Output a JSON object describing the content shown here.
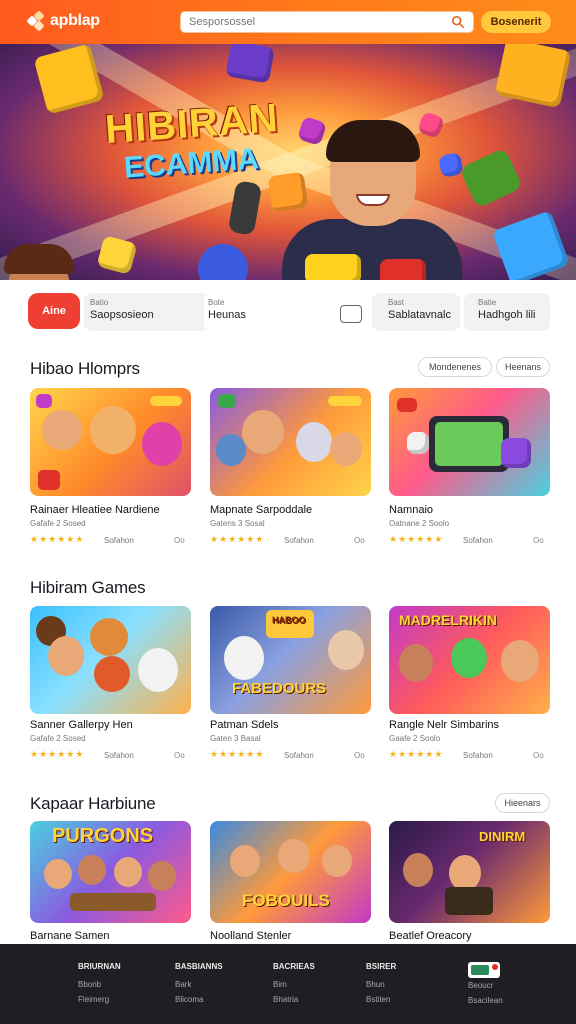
{
  "header": {
    "logo_text": "apblap",
    "search_placeholder": "Sesporsossel",
    "cta_label": "Bosenerit"
  },
  "hero": {
    "title": "HIBIRAN",
    "subtitle": "ECAMMA"
  },
  "filters": {
    "primary_chip": "Aine",
    "chip1": {
      "caption": "Batio",
      "value": "Saopsosieon"
    },
    "chip2": {
      "caption": "Bote",
      "value": "Heunas"
    },
    "chip3": {
      "caption": "Bast",
      "value": "Sablatavnalc"
    },
    "chip4": {
      "caption": "Batie",
      "value": "Hadhgoh lili"
    }
  },
  "sections": [
    {
      "title": "Hibao Hlomprs",
      "pills": [
        "Mondenenes",
        "Heenans"
      ],
      "cards": [
        {
          "title": "Rainaer Hleatiee Nardiene",
          "meta": "Gafafe 2 Sosed",
          "stars": "★★★★★★",
          "count": "Sofahon",
          "num": "Oo"
        },
        {
          "title": "Mapnate Sarpoddale",
          "meta": "Gatens 3 Sosal",
          "stars": "★★★★★★",
          "count": "Sofahon",
          "num": "Oo"
        },
        {
          "title": "Namnaio",
          "meta": "Oatnane 2 Soolo",
          "stars": "★★★★★★",
          "count": "Sofahon",
          "num": "Oo"
        }
      ]
    },
    {
      "title": "Hibiram Games",
      "pills": [],
      "cards": [
        {
          "title": "Sanner Gallerpy Hen",
          "meta": "Gafafe 2 Sosed",
          "stars": "★★★★★★",
          "count": "Sofahon",
          "num": "Oo"
        },
        {
          "title": "Patman Sdels",
          "meta": "Gaten 3 Basal",
          "stars": "★★★★★★",
          "count": "Sofahon",
          "num": "Oo"
        },
        {
          "title": "Rangle Nelr Simbarins",
          "meta": "Gaafe 2 Soolo",
          "stars": "★★★★★★",
          "count": "Sofahon",
          "num": "Oo"
        }
      ]
    },
    {
      "title": "Kapaar Harbiune",
      "pills": [
        "Hieenars"
      ],
      "cards": [
        {
          "title": "Barnane Samen"
        },
        {
          "title": "Noolland Stenler"
        },
        {
          "title": "Beatlef Oreacory"
        }
      ]
    }
  ],
  "thumb_texts": {
    "s2c2_banner": "FABEDOURS",
    "s2c2_sign": "HABOO",
    "s2c3_banner": "MADRELRIKIN",
    "s3c1_banner": "PURGONS",
    "s3c2_banner": "FOBOUILS",
    "s3c3_banner": "DINIRM"
  },
  "footer": {
    "columns": [
      {
        "head": "BRIURNAN",
        "links": [
          "Bbonb",
          "Fleimerg"
        ]
      },
      {
        "head": "BASBIANNS",
        "links": [
          "Bark",
          "Blicoma"
        ]
      },
      {
        "head": "BACRIEAS",
        "links": [
          "Bim",
          "Bhatria"
        ]
      },
      {
        "head": "BSIRER",
        "links": [
          "Bhun",
          "Bstiten"
        ]
      },
      {
        "head": "",
        "links": [
          "Beoucr",
          "Bsacilean"
        ]
      }
    ]
  },
  "colors": {
    "brand": "#ff6a1f",
    "accent": "#ffc83d",
    "primary_chip": "#ef3e32",
    "stars": "#f6b21a",
    "footer_bg": "#1f1f23"
  }
}
